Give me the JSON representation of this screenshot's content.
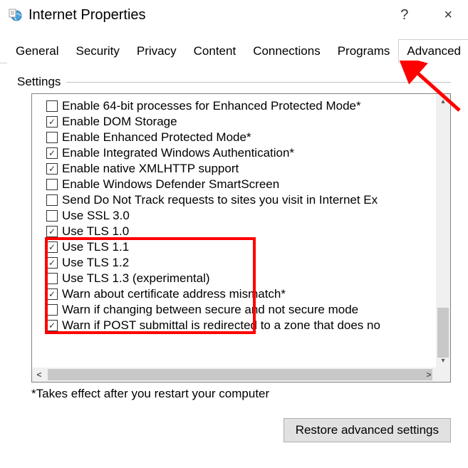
{
  "titlebar": {
    "title": "Internet Properties",
    "help": "?",
    "close": "×"
  },
  "tabs": [
    {
      "label": "General",
      "active": false
    },
    {
      "label": "Security",
      "active": false
    },
    {
      "label": "Privacy",
      "active": false
    },
    {
      "label": "Content",
      "active": false
    },
    {
      "label": "Connections",
      "active": false
    },
    {
      "label": "Programs",
      "active": false
    },
    {
      "label": "Advanced",
      "active": true
    }
  ],
  "settings": {
    "group_label": "Settings",
    "items": [
      {
        "checked": false,
        "label": "Enable 64-bit processes for Enhanced Protected Mode*"
      },
      {
        "checked": true,
        "label": "Enable DOM Storage"
      },
      {
        "checked": false,
        "label": "Enable Enhanced Protected Mode*"
      },
      {
        "checked": true,
        "label": "Enable Integrated Windows Authentication*"
      },
      {
        "checked": true,
        "label": "Enable native XMLHTTP support"
      },
      {
        "checked": false,
        "label": "Enable Windows Defender SmartScreen"
      },
      {
        "checked": false,
        "label": "Send Do Not Track requests to sites you visit in Internet Ex"
      },
      {
        "checked": false,
        "label": "Use SSL 3.0"
      },
      {
        "checked": true,
        "label": "Use TLS 1.0"
      },
      {
        "checked": true,
        "label": "Use TLS 1.1"
      },
      {
        "checked": true,
        "label": "Use TLS 1.2"
      },
      {
        "checked": false,
        "label": "Use TLS 1.3 (experimental)"
      },
      {
        "checked": true,
        "label": "Warn about certificate address mismatch*"
      },
      {
        "checked": false,
        "label": "Warn if changing between secure and not secure mode"
      },
      {
        "checked": true,
        "label": "Warn if POST submittal is redirected to a zone that does no"
      }
    ],
    "note": "*Takes effect after you restart your computer"
  },
  "buttons": {
    "restore": "Restore advanced settings"
  },
  "annotation": {
    "highlight_indices": [
      7,
      8,
      9,
      10,
      11
    ],
    "arrow_target": "tab-advanced"
  }
}
